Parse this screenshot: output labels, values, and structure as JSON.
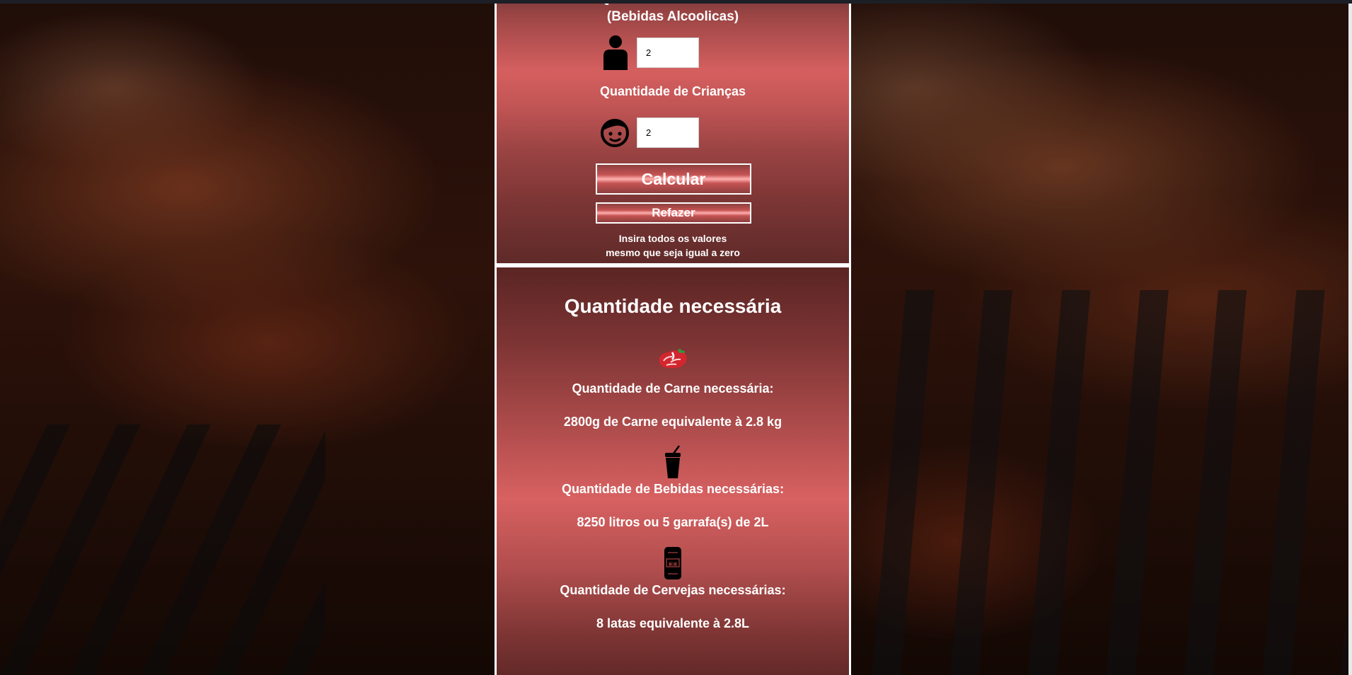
{
  "form": {
    "cut_title": "Quantidade de Adultos",
    "subtitle": "(Bebidas Alcoolicas)",
    "adults_value": "2",
    "kids_label": "Quantidade de Crianças",
    "kids_value": "2",
    "calculate_label": "Calcular",
    "redo_label": "Refazer",
    "hint_line1": "Insira todos os valores",
    "hint_line2": "mesmo que seja igual a zero",
    "icons": [
      "adult-person-icon",
      "child-face-icon"
    ]
  },
  "result": {
    "title": "Quantidade necessária",
    "meat": {
      "icon": "meat-steak-icon",
      "label": "Quantidade de Carne necessária:",
      "value": "2800g de Carne equivalente à 2.8 kg"
    },
    "drinks": {
      "icon": "soda-cup-icon",
      "label": "Quantidade de Bebidas necessárias:",
      "value": "8250 litros ou 5 garrafa(s) de 2L"
    },
    "beer": {
      "icon": "beer-can-icon",
      "label": "Quantidade de Cervejas necessárias:",
      "value": "8 latas equivalente à 2.8L"
    }
  },
  "colors": {
    "panel_light": "#d86161",
    "panel_dark": "#5b2625",
    "border": "#ffffff",
    "text": "#ffffff"
  }
}
